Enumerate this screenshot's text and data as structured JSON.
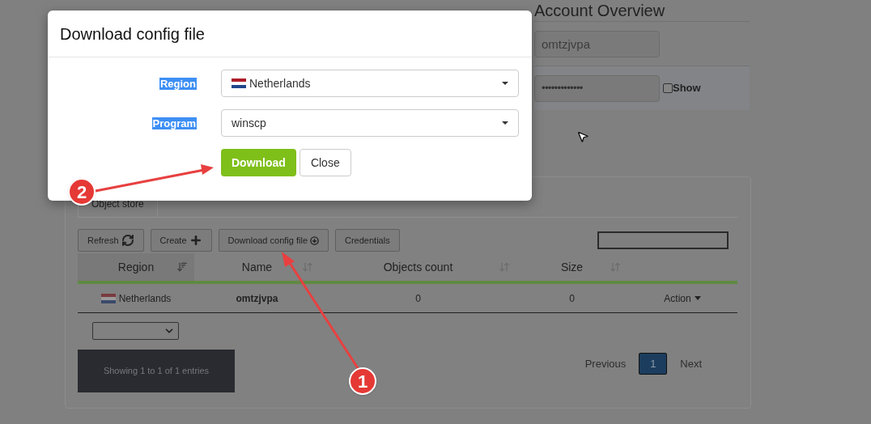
{
  "account_overview": {
    "title": "Account Overview",
    "username": "omtzjvpa",
    "password_mask": "•••••••••••••",
    "show_password": {
      "label": "Show",
      "checked": false
    }
  },
  "panel": {
    "tabs": [
      {
        "label": "Object store",
        "selected": true
      }
    ],
    "toolbar": [
      {
        "label": "Refresh"
      },
      {
        "label": "Create"
      },
      {
        "label": "Download config file"
      },
      {
        "label": "Credentials"
      }
    ],
    "table": {
      "columns": [
        {
          "label": "Region",
          "sorted": true
        },
        {
          "label": "Name",
          "sorted": false
        },
        {
          "label": "Objects count",
          "sorted": false
        },
        {
          "label": "Size",
          "sorted": false
        }
      ],
      "rows": [
        {
          "region": "Netherlands",
          "name": "omtzjvpa",
          "objects_count": "0",
          "size": "0",
          "action": "Action"
        }
      ]
    },
    "info": "Showing 1 to 1 of 1 entries",
    "pagination": [
      {
        "label": "Previous",
        "kind": "link",
        "selected": false
      },
      {
        "label": "1",
        "kind": "page",
        "selected": true
      },
      {
        "label": "Next",
        "kind": "link",
        "selected": false
      }
    ]
  },
  "dialog": {
    "title": "Download config file",
    "fields": [
      {
        "label": "Region",
        "value": "Netherlands",
        "flag": true
      },
      {
        "label": "Program",
        "value": "winscp",
        "flag": false
      }
    ],
    "buttons": [
      {
        "label": "Download",
        "kind": "primary"
      },
      {
        "label": "Close",
        "kind": "default"
      }
    ]
  },
  "annotations": [
    {
      "number": "1"
    },
    {
      "number": "2"
    }
  ]
}
